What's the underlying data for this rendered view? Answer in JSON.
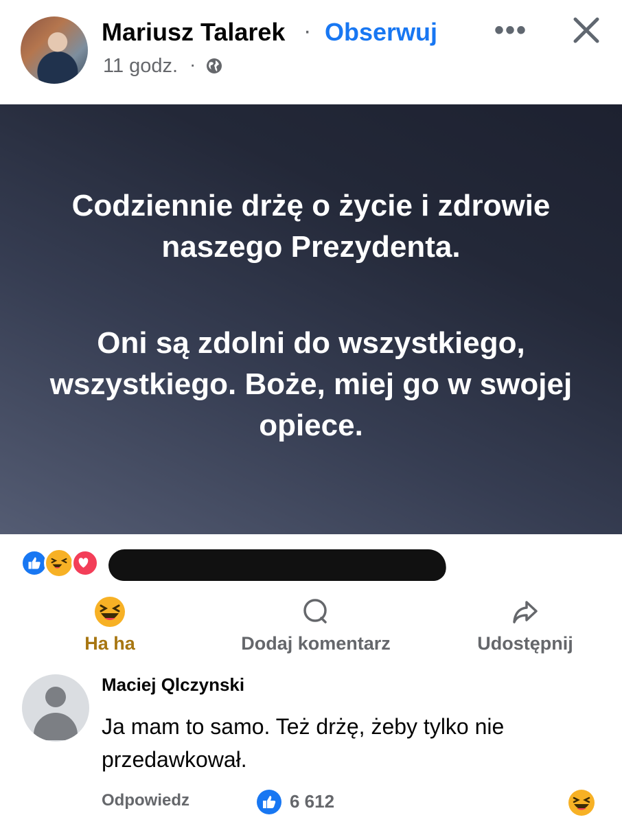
{
  "post": {
    "author": "Mariusz Talarek",
    "separator": "·",
    "follow_label": "Obserwuj",
    "timestamp": "11 godz.",
    "timestamp_separator": "·",
    "more_label": "•••",
    "body_paragraph_1": "Codziennie drżę o życie i zdrowie naszego Prezydenta.",
    "body_paragraph_2": "Oni są zdolni do wszystkiego, wszystkiego. Boże, miej go w swojej opiece.",
    "background_color": "#2a3042"
  },
  "reactions": {
    "types": [
      "like",
      "haha",
      "love"
    ]
  },
  "actions": {
    "haha_label": "Ha ha",
    "comment_label": "Dodaj komentarz",
    "share_label": "Udostępnij"
  },
  "comment": {
    "author": "Maciej Qlczynski",
    "text": "Ja mam to samo. Też drżę, żeby tylko nie przedawkował.",
    "reply_label": "Odpowiedz",
    "like_count": "6 612"
  },
  "colors": {
    "accent": "#1877f2",
    "haha": "#f7b125",
    "love": "#f33e58",
    "secondary_text": "#65676b"
  }
}
